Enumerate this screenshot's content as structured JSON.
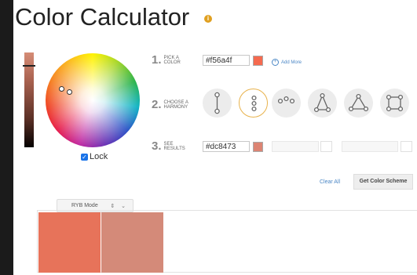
{
  "title": "Color Calculator",
  "info_icon": "i",
  "lock_label": "Lock",
  "mode_select": {
    "value": "RYB Mode",
    "arrows": "⇕ ⌄"
  },
  "steps": [
    {
      "num": "1.",
      "label": "PICK A\nCOLOR"
    },
    {
      "num": "2.",
      "label": "CHOOSE A\nHARMONY"
    },
    {
      "num": "3.",
      "label": "SEE\nRESULTS"
    }
  ],
  "pick": {
    "hex": "#f56a4f",
    "color": "#f56a4f",
    "add_more": "Add More"
  },
  "harmonies": [
    "complementary-icon",
    "monochromatic-icon",
    "analogous-icon",
    "split-complementary-icon",
    "triad-icon",
    "tetrad-icon"
  ],
  "result": {
    "hex": "#dc8473",
    "color": "#dc8473"
  },
  "actions": {
    "clear_all": "Clear All",
    "get_scheme": "Get Color Scheme"
  },
  "palette": {
    "colors": [
      "#e7735a",
      "#d48a79"
    ]
  },
  "colors": {
    "link": "#4a86c5",
    "active_ring": "#e8b24c",
    "lock_check": "#1a73e8"
  }
}
